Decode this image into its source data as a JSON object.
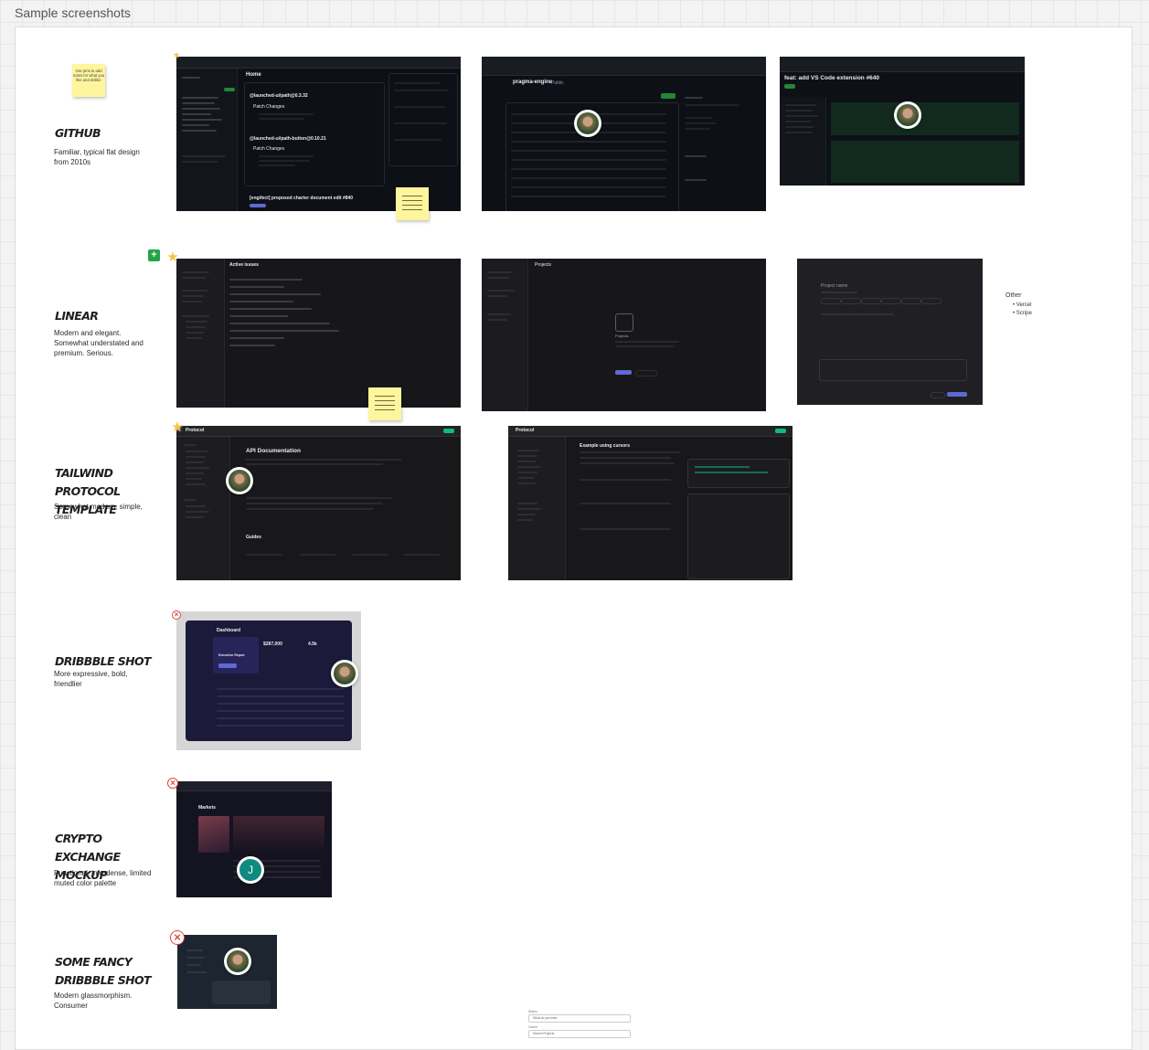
{
  "frame_title": "Sample screenshots",
  "sections": [
    {
      "heading": "GITHUB",
      "description": "Familiar, typical flat design from 2010s"
    },
    {
      "heading": "LINEAR",
      "description": "Modern and elegant. Somewhat understated and premium. Serious."
    },
    {
      "heading": "TAILWIND PROTOCOL TEMPLATE",
      "description": "Somewhat modern, simple, clean"
    },
    {
      "heading": "DRIBBBLE SHOT",
      "description": "More expressive, bold, friendlier"
    },
    {
      "heading": "CRYPTO EXCHANGE MOCKUP",
      "description": "Functional, info-dense, limited muted color palette"
    },
    {
      "heading": "SOME FANCY DRIBBBLE SHOT",
      "description": "Modern glassmorphism. Consumer"
    }
  ],
  "sticky_note_text": "Use pins to add notes for what you like and dislike",
  "other": {
    "label": "Other",
    "items": [
      "Vercel",
      "Scripe"
    ]
  },
  "screenshots": {
    "github_home": {
      "title": "Home",
      "release_1": "@launched-ui/path@0.3.32",
      "release_2": "@launched-ui/path-button@0.10.21",
      "changes": "Patch Changes",
      "pr": "[engifect] proposed charter document edit #840"
    },
    "github_repo": {
      "repo": "pragma-engine",
      "tag": "Public"
    },
    "github_pr": {
      "title": "feat: add VS Code extension #640",
      "badge": "Open"
    },
    "linear_issues": {
      "title": "Active issues"
    },
    "linear_projects": {
      "title": "Projects",
      "empty": "Projects"
    },
    "linear_modal": {
      "placeholder": "Project name",
      "button": "Create project"
    },
    "tailwind_api": {
      "brand": "Protocol",
      "title": "API Documentation",
      "section": "Guides"
    },
    "tailwind_pagination": {
      "brand": "Protocol",
      "title": "Example using cursors"
    },
    "dribbble": {
      "title": "Dashboard",
      "stat_1": "$287,000",
      "stat_2": "4.5k",
      "card": "Executive Report"
    },
    "crypto": {
      "title": "Markets"
    },
    "avatar_initial": "J"
  },
  "dropdown": {
    "label_1": "Status",
    "value_1": "What do you want",
    "label_2": "Owner",
    "value_2": "Search Projects"
  }
}
